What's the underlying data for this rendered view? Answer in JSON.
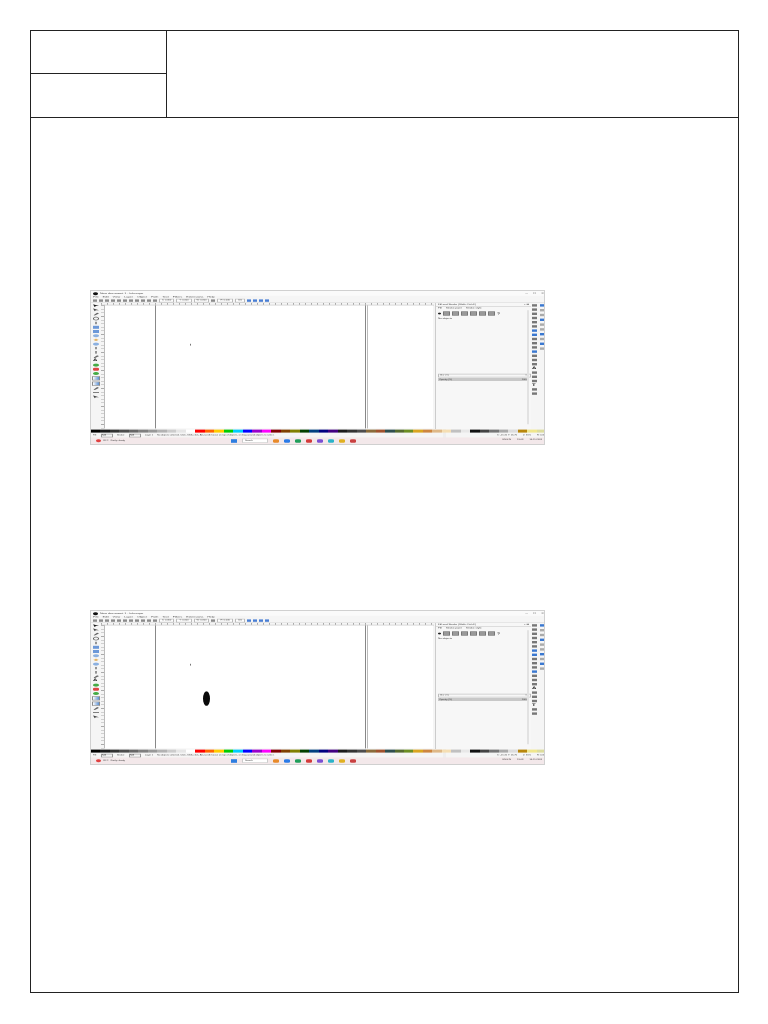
{
  "page": {
    "header": {
      "cell_left_top": "",
      "cell_left_bottom": "",
      "cell_right": ""
    }
  },
  "screenshots": [
    {
      "title": "New document 1 - Inkscape",
      "menu": [
        "File",
        "Edit",
        "View",
        "Layer",
        "Object",
        "Path",
        "Text",
        "Filters",
        "Extensions",
        "Help"
      ],
      "window_controls": [
        "–",
        "□",
        "×"
      ],
      "toolbar_fields": {
        "x": "X: 0.000",
        "y": "Y: 0.000",
        "w": "W: 0.000",
        "h": "H: 0.000",
        "unit": "mm"
      },
      "dock": {
        "title": "Fill and Stroke (Shift+Ctrl+F)",
        "close": "× ⊞",
        "tabs": [
          "Fill",
          "Stroke paint",
          "Stroke style"
        ],
        "help": "?",
        "no_objects": "No objects",
        "blend_label": "Blur (%)",
        "blend_value": "0.0",
        "opacity_label": "Opacity (%)",
        "opacity_value": "100.0"
      },
      "status": {
        "fill_label": "Fill:",
        "stroke_label": "Stroke:",
        "fill_value": "N/A",
        "stroke_value": "N/A",
        "layer": "Layer 1",
        "message": "No objects selected. Click, Shift+click, Alt+scroll mouse on top of objects, or drag around objects to select.",
        "coords": "X: -15.31  Y: 16.76",
        "zoom": "Z: 35%",
        "rotation": "R: 0.00°"
      },
      "taskbar": {
        "weather": "28°C",
        "weather_desc": "Partly cloudy",
        "search": "Search",
        "lang": "ENG IN",
        "time": "19:08",
        "date": "16-11-2024"
      },
      "ellipse_drawn": false
    },
    {
      "title": "New document 1 - Inkscape",
      "menu": [
        "File",
        "Edit",
        "View",
        "Layer",
        "Object",
        "Path",
        "Text",
        "Filters",
        "Extensions",
        "Help"
      ],
      "window_controls": [
        "–",
        "□",
        "×"
      ],
      "toolbar_fields": {
        "x": "X: 0.000",
        "y": "Y: 0.000",
        "w": "W: 0.000",
        "h": "H: 0.000",
        "unit": "mm"
      },
      "dock": {
        "title": "Fill and Stroke (Shift+Ctrl+F)",
        "close": "× ⊞",
        "tabs": [
          "Fill",
          "Stroke paint",
          "Stroke style"
        ],
        "help": "?",
        "no_objects": "No objects",
        "blend_label": "Blur (%)",
        "blend_value": "0.0",
        "opacity_label": "Opacity (%)",
        "opacity_value": "100.0"
      },
      "status": {
        "fill_label": "Fill:",
        "stroke_label": "Stroke:",
        "fill_value": "N/A",
        "stroke_value": "N/A",
        "layer": "Layer 1",
        "message": "No objects selected. Click, Shift+click, Alt+scroll mouse on top of objects, or drag around objects to select.",
        "coords": "X: -15.31  Y: 16.76",
        "zoom": "Z: 35%",
        "rotation": "R: 0.00°"
      },
      "taskbar": {
        "weather": "28°C",
        "weather_desc": "Partly cloudy",
        "search": "Search",
        "lang": "ENG IN",
        "time": "19:08",
        "date": "16-11-2024"
      },
      "ellipse_drawn": true
    }
  ],
  "palette_colors": [
    "#000000",
    "#1a1a1a",
    "#333333",
    "#4d4d4d",
    "#666666",
    "#808080",
    "#999999",
    "#b3b3b3",
    "#cccccc",
    "#e6e6e6",
    "#ffffff",
    "#ff0000",
    "#ff6600",
    "#ffcc00",
    "#00cc00",
    "#00ccff",
    "#0000ff",
    "#9900cc",
    "#ff00ff",
    "#800000",
    "#804000",
    "#808000",
    "#004000",
    "#004080",
    "#000080",
    "#400080",
    "#1a1a1a",
    "#333333",
    "#4d4d4d",
    "#8a6b3a",
    "#a0522d",
    "#2f4f4f",
    "#556b2f",
    "#6b8e23",
    "#daa520",
    "#cd853f",
    "#deb887",
    "#f5deb3",
    "#c0c0c0",
    "#e8e8e8",
    "#111111",
    "#444444",
    "#777777",
    "#aaaaaa",
    "#dddddd",
    "#b8860b",
    "#f0e68c",
    "#dcdc9c"
  ],
  "taskbar_app_colors": [
    "#e88a2a",
    "#2a7be8",
    "#1f9e5a",
    "#d43a3a",
    "#7a4fd4",
    "#2bb3c9",
    "#e0b020",
    "#c94040"
  ]
}
